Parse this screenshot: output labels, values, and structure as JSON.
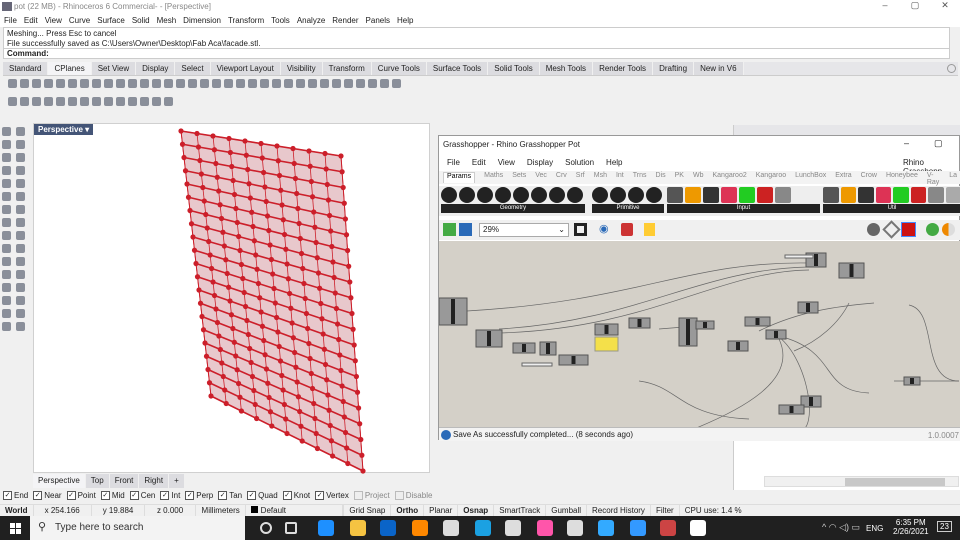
{
  "window": {
    "title": "pot (22 MB) - Rhinoceros 6 Commercial- - [Perspective]"
  },
  "menu": [
    "File",
    "Edit",
    "View",
    "Curve",
    "Surface",
    "Solid",
    "Mesh",
    "Dimension",
    "Transform",
    "Tools",
    "Analyze",
    "Render",
    "Panels",
    "Help"
  ],
  "command": {
    "history": [
      "Meshing... Press Esc to cancel",
      "File successfully saved as C:\\Users\\Owner\\Desktop\\Fab Aca\\facade.stl."
    ],
    "prompt": "Command:"
  },
  "tabs": [
    "Standard",
    "CPlanes",
    "Set View",
    "Display",
    "Select",
    "Viewport Layout",
    "Visibility",
    "Transform",
    "Curve Tools",
    "Surface Tools",
    "Solid Tools",
    "Mesh Tools",
    "Render Tools",
    "Drafting",
    "New in V6"
  ],
  "active_tab": "CPlanes",
  "viewport": {
    "label": "Perspective",
    "mesh_color": "#cc1f2a"
  },
  "view_tabs": [
    "Perspective",
    "Top",
    "Front",
    "Right",
    "+"
  ],
  "osnaps": [
    {
      "l": "End",
      "on": true
    },
    {
      "l": "Near",
      "on": true
    },
    {
      "l": "Point",
      "on": true
    },
    {
      "l": "Mid",
      "on": true
    },
    {
      "l": "Cen",
      "on": true
    },
    {
      "l": "Int",
      "on": true
    },
    {
      "l": "Perp",
      "on": true
    },
    {
      "l": "Tan",
      "on": true
    },
    {
      "l": "Quad",
      "on": true
    },
    {
      "l": "Knot",
      "on": true
    },
    {
      "l": "Vertex",
      "on": true
    },
    {
      "l": "Project",
      "on": false
    },
    {
      "l": "Disable",
      "on": false
    }
  ],
  "status": {
    "cplane": "World",
    "x": "x 254.166",
    "y": "y 19.884",
    "z": "z 0.000",
    "units": "Millimeters",
    "layer": "Default",
    "grid_snap": "Grid Snap",
    "ortho": "Ortho",
    "planar": "Planar",
    "osnap": "Osnap",
    "smarttrack": "SmartTrack",
    "gumball": "Gumball",
    "record_history": "Record History",
    "filter": "Filter",
    "cpu": "CPU use: 1.4 %"
  },
  "taskbar": {
    "search_placeholder": "Type here to search",
    "lang": "ENG",
    "time": "6:35 PM",
    "date": "2/26/2021",
    "notifications": "23"
  },
  "grasshopper": {
    "title": "Grasshopper - Rhino Grasshopper Pot",
    "menu": [
      "File",
      "Edit",
      "View",
      "Display",
      "Solution",
      "Help"
    ],
    "doc_name": "Rhino Grasshopp",
    "tabs": [
      "Params",
      "Maths",
      "Sets",
      "Vec",
      "Crv",
      "Srf",
      "Msh",
      "Int",
      "Trns",
      "Dis",
      "PK",
      "Wb",
      "Kangaroo2",
      "Kangaroo",
      "LunchBox",
      "Extra",
      "Crow",
      "Honeybee",
      "V-Ray",
      "La"
    ],
    "groups": [
      "Geometry",
      "Primitive",
      "Input",
      "Util"
    ],
    "zoom": "29%",
    "status": "Save As successfully completed... (8 seconds ago)",
    "version": "1.0.0007"
  }
}
